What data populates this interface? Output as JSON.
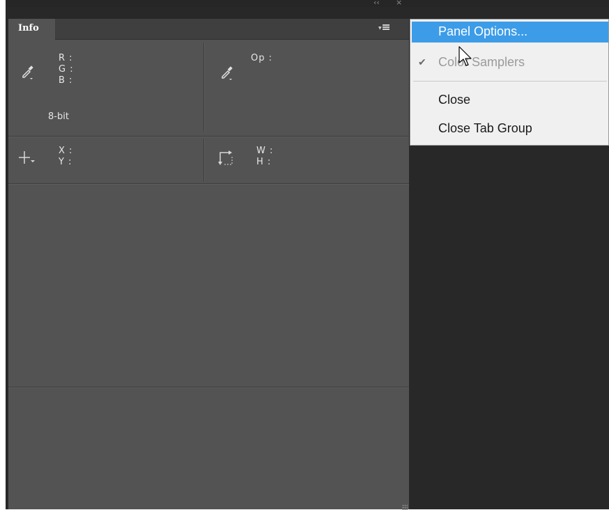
{
  "panel": {
    "tab_label": "Info",
    "color_readout": {
      "r_label": "R :",
      "g_label": "G :",
      "b_label": "B :",
      "r": "",
      "g": "",
      "b": "",
      "bit_depth": "8-bit"
    },
    "opacity_readout": {
      "op_label": "Op :",
      "op": ""
    },
    "position_readout": {
      "x_label": "X :",
      "y_label": "Y :",
      "x": "",
      "y": ""
    },
    "size_readout": {
      "w_label": "W :",
      "h_label": "H :",
      "w": "",
      "h": ""
    }
  },
  "flyout_menu": {
    "items": [
      {
        "label": "Panel Options...",
        "highlighted": true,
        "checked": false,
        "enabled": true
      },
      {
        "label": "Color Samplers",
        "highlighted": false,
        "checked": true,
        "enabled": false
      },
      {
        "label": "Close",
        "highlighted": false,
        "checked": false,
        "enabled": true
      },
      {
        "label": "Close Tab Group",
        "highlighted": false,
        "checked": false,
        "enabled": true
      }
    ]
  },
  "colors": {
    "app_background": "#282828",
    "panel_background": "#535353",
    "menu_background": "#f0f0f0",
    "menu_highlight": "#3d9ce8"
  },
  "icons": {
    "eyedropper": "eyedropper-icon",
    "crosshair": "crosshair-icon",
    "selection_size": "selection-size-icon",
    "panel_menu": "panel-menu-icon",
    "check": "checkmark-icon",
    "pointer": "mouse-pointer-icon"
  }
}
